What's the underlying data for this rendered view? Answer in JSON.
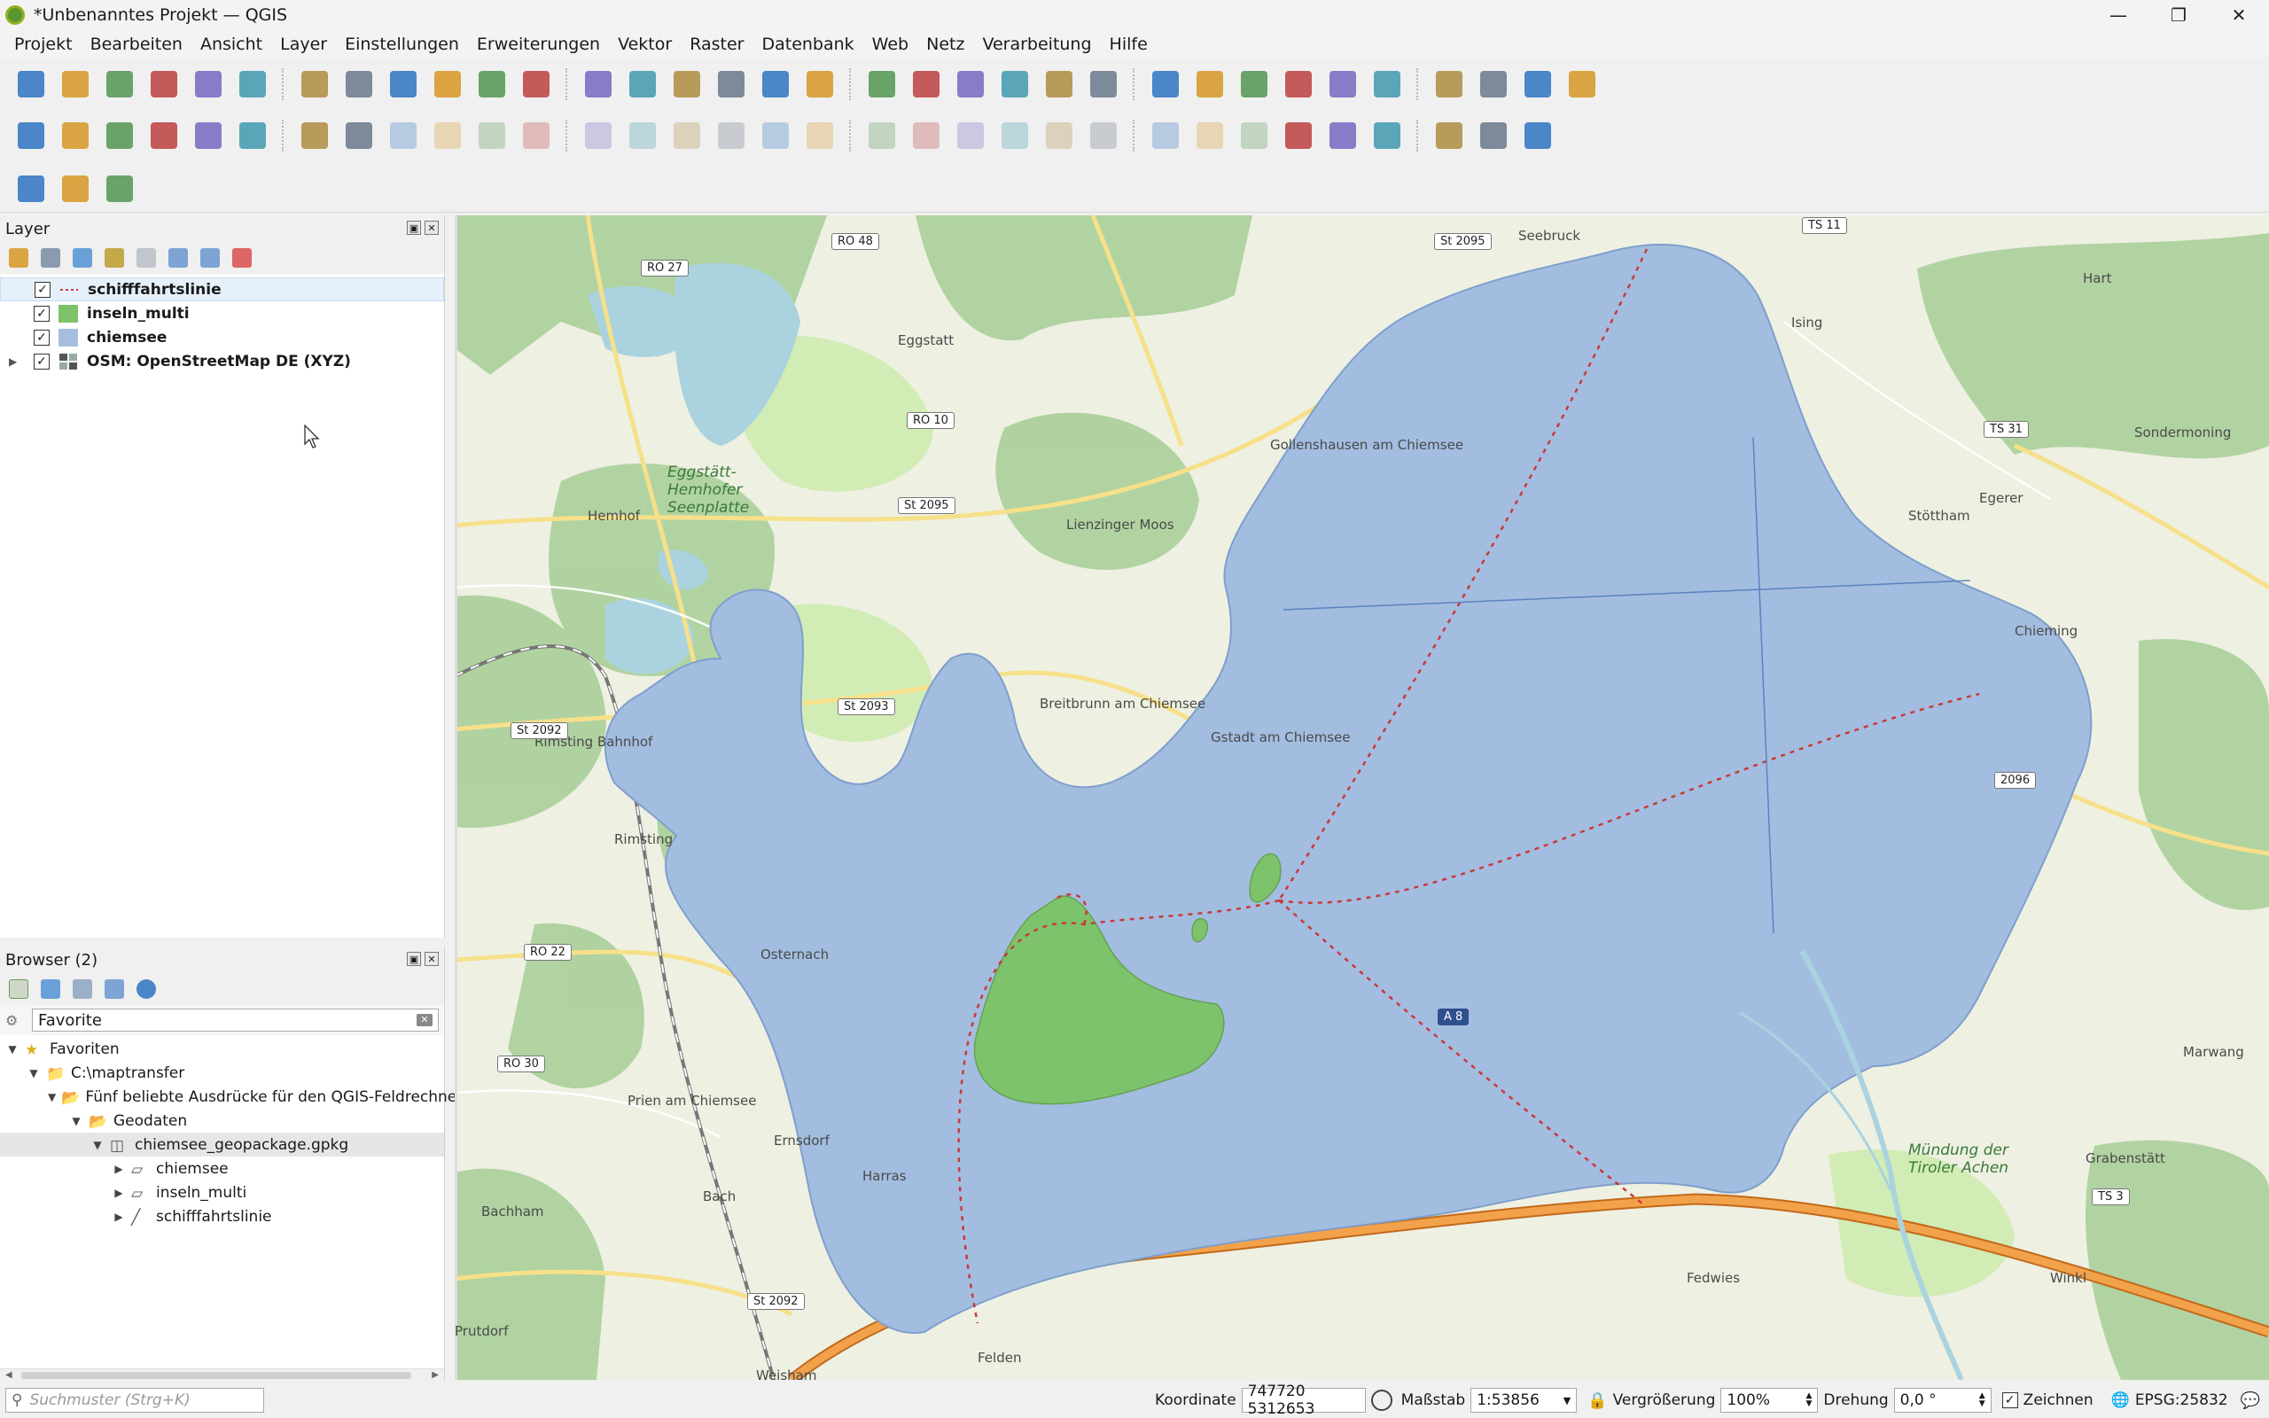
{
  "window": {
    "title": "*Unbenanntes Projekt — QGIS"
  },
  "menu": [
    "Projekt",
    "Bearbeiten",
    "Ansicht",
    "Layer",
    "Einstellungen",
    "Erweiterungen",
    "Vektor",
    "Raster",
    "Datenbank",
    "Web",
    "Netz",
    "Verarbeitung",
    "Hilfe"
  ],
  "toolbar1_icons": [
    "new-project-icon",
    "open-project-icon",
    "save-project-icon",
    "new-print-layout-icon",
    "layout-manager-icon",
    "style-manager-icon",
    "pan-icon",
    "pan-to-selection-icon",
    "zoom-in-icon",
    "zoom-out-icon",
    "zoom-full-icon",
    "zoom-to-selection-icon",
    "zoom-to-layer-icon",
    "zoom-native-icon",
    "zoom-last-icon",
    "zoom-next-icon",
    "new-map-view-icon",
    "new-3d-view-icon",
    "new-bookmark-icon",
    "show-bookmarks-icon",
    "temporal-controller-icon",
    "refresh-icon",
    "select-features-icon",
    "select-by-value-icon",
    "deselect-icon",
    "select-location-icon",
    "identify-icon",
    "attribute-table-icon",
    "processing-toolbox-icon",
    "statistics-icon",
    "open-field-calculator-icon",
    "measure-icon",
    "map-tips-icon",
    "locator-settings-icon"
  ],
  "toolbar2_icons": [
    "add-vector-layer-icon",
    "add-raster-layer-icon",
    "add-delimited-text-icon",
    "add-spatialite-icon",
    "add-virtual-layer-icon",
    "add-wms-icon",
    "add-xyz-icon",
    "current-edits-icon",
    "toggle-editing-icon",
    "save-edits-icon",
    "digitize-icon",
    "vertex-tool-icon",
    "modify-attributes-icon",
    "delete-selected-icon",
    "cut-features-icon",
    "copy-features-icon",
    "paste-features-icon",
    "undo-icon",
    "redo-icon",
    "label-icon",
    "label-toolbar-pin-icon",
    "label-highlight-icon",
    "label-change-icon",
    "label-move-icon",
    "label-rotate-icon",
    "label-show-hide-icon",
    "label-diagram-icon",
    "label-callout-icon",
    "globe-icon",
    "qms-icon",
    "openlayers-icon",
    "python-console-icon",
    "help-icon"
  ],
  "toolbar3_icons": [
    "locator-search-icon",
    "measure-angle-icon",
    "cloud-plugin-icon"
  ],
  "layers_panel": {
    "title": "Layer",
    "layers": [
      {
        "name": "schifffahrtslinie",
        "checked": true,
        "symbol": "dashed-line",
        "color": "#c83a3a"
      },
      {
        "name": "inseln_multi",
        "checked": true,
        "symbol": "fill",
        "color": "#7dc36b"
      },
      {
        "name": "chiemsee",
        "checked": true,
        "symbol": "fill",
        "color": "#a7bde0"
      },
      {
        "name": "OSM: OpenStreetMap DE (XYZ)",
        "checked": true,
        "symbol": "raster"
      }
    ]
  },
  "browser_panel": {
    "title": "Browser (2)",
    "filter_value": "Favorite",
    "tree": [
      {
        "label": "Favoriten",
        "level": 0,
        "icon": "star"
      },
      {
        "label": "C:\\maptransfer",
        "level": 1,
        "icon": "folder"
      },
      {
        "label": "Fünf beliebte Ausdrücke für den QGIS-Feldrechne",
        "level": 2,
        "icon": "folder-open"
      },
      {
        "label": "Geodaten",
        "level": 3,
        "icon": "folder-open"
      },
      {
        "label": "chiemsee_geopackage.gpkg",
        "level": 4,
        "icon": "geopackage"
      },
      {
        "label": "chiemsee",
        "level": 5,
        "icon": "polygon"
      },
      {
        "label": "inseln_multi",
        "level": 5,
        "icon": "polygon"
      },
      {
        "label": "schifffahrtslinie",
        "level": 5,
        "icon": "line"
      }
    ]
  },
  "map_labels": {
    "places": [
      "Seebruck",
      "Eggstatt",
      "Ising",
      "Hart",
      "Sondermoning",
      "Gollenshausen am Chiemsee",
      "Eggstätt-Hemhofer Seenplatte",
      "Hemhof",
      "Lienzinger Moos",
      "Stöttham",
      "Egerer",
      "Chieming",
      "Breitbrunn am Chiemsee",
      "Gstadt am Chiemsee",
      "Rimsting Bahnhof",
      "Rimsting",
      "Osternach",
      "Prien am Chiemsee",
      "Ernsdorf",
      "Harras",
      "Bach",
      "Bachham",
      "Prutdorf",
      "Weisham",
      "Mündung der Tiroler Achen",
      "Grabenstätt",
      "Marwang",
      "Winkl",
      "Fedwies",
      "Felden"
    ],
    "road_signs": [
      "RO 48",
      "RO 27",
      "St 2095",
      "TS 11",
      "RO 10",
      "St 2095",
      "TS 31",
      "St 2093",
      "St 2092",
      "2096",
      "RO 22",
      "RO 30",
      "A 8",
      "St 2092",
      "TS 3"
    ]
  },
  "status": {
    "search_placeholder": "Suchmuster (Strg+K)",
    "coordinate_label": "Koordinate",
    "coordinate_value": "747720  5312653",
    "scale_label": "Maßstab",
    "scale_value": "1:53856",
    "magnifier_label": "Vergrößerung",
    "magnifier_value": "100%",
    "rotation_label": "Drehung",
    "rotation_value": "0,0 °",
    "render_label": "Zeichnen",
    "crs": "EPSG:25832"
  },
  "colors": {
    "lake": "#a3bde0",
    "island": "#7dc36b",
    "ferry_line": "#c83a3a",
    "motorway": "#e8923a"
  }
}
